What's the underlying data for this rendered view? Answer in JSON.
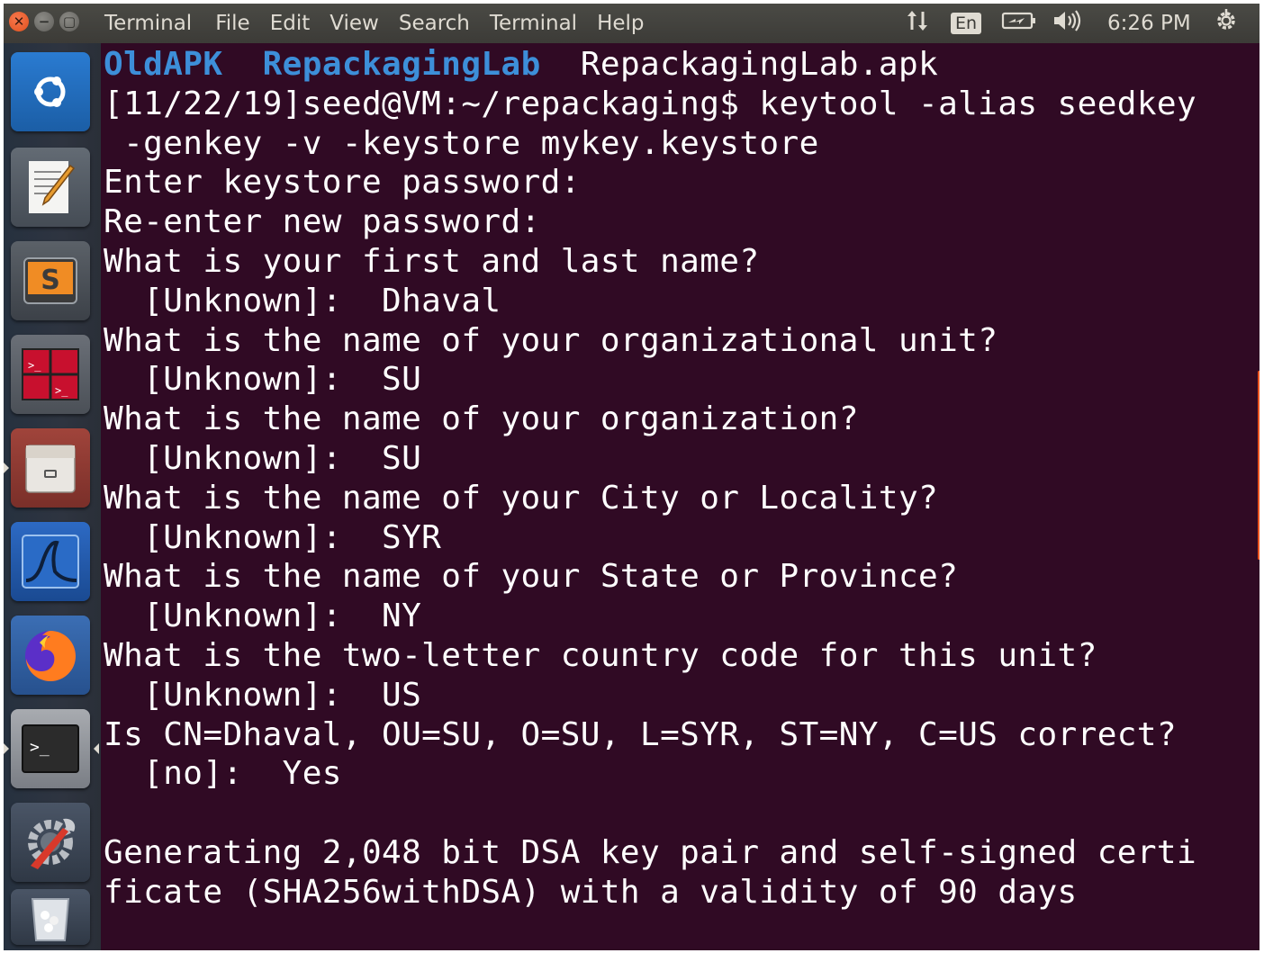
{
  "window": {
    "title": "Terminal",
    "menu": [
      "File",
      "Edit",
      "View",
      "Search",
      "Terminal",
      "Help"
    ]
  },
  "tray": {
    "keyboard_layout": "En",
    "time": "6:26 PM",
    "icons": [
      "network-updown-icon",
      "battery-icon",
      "volume-icon",
      "power-gear-icon"
    ]
  },
  "launcher": {
    "items": [
      {
        "name": "ubuntu-dash-icon",
        "color": "#1b5ea6"
      },
      {
        "name": "text-editor-icon",
        "color": "#525a63"
      },
      {
        "name": "sublime-text-icon",
        "color": "#4a4f55"
      },
      {
        "name": "terminator-icon",
        "color": "#5a5f66"
      },
      {
        "name": "file-manager-icon",
        "color": "#8a3a33"
      },
      {
        "name": "wireshark-icon",
        "color": "#1d4e9a"
      },
      {
        "name": "firefox-icon",
        "color": "#2e5fa3"
      },
      {
        "name": "terminal-icon",
        "color": "#6a6e75"
      },
      {
        "name": "system-settings-icon",
        "color": "#3a4453"
      },
      {
        "name": "trash-icon",
        "color": "#3a4453"
      }
    ]
  },
  "terminal": {
    "ls_output": [
      "OldAPK",
      "RepackagingLab",
      "RepackagingLab.apk"
    ],
    "lines": [
      "[11/22/19]seed@VM:~/repackaging$ keytool -alias seedkey",
      " -genkey -v -keystore mykey.keystore",
      "Enter keystore password:",
      "Re-enter new password:",
      "What is your first and last name?",
      "  [Unknown]:  Dhaval",
      "What is the name of your organizational unit?",
      "  [Unknown]:  SU",
      "What is the name of your organization?",
      "  [Unknown]:  SU",
      "What is the name of your City or Locality?",
      "  [Unknown]:  SYR",
      "What is the name of your State or Province?",
      "  [Unknown]:  NY",
      "What is the two-letter country code for this unit?",
      "  [Unknown]:  US",
      "Is CN=Dhaval, OU=SU, O=SU, L=SYR, ST=NY, C=US correct?",
      "  [no]:  Yes",
      "",
      "Generating 2,048 bit DSA key pair and self-signed certi",
      "ficate (SHA256withDSA) with a validity of 90 days"
    ]
  },
  "colors": {
    "terminal_bg": "#300a24",
    "panel_bg": "#3c3b37",
    "ls_dir": "#3d8fd9",
    "accent": "#e95420"
  }
}
